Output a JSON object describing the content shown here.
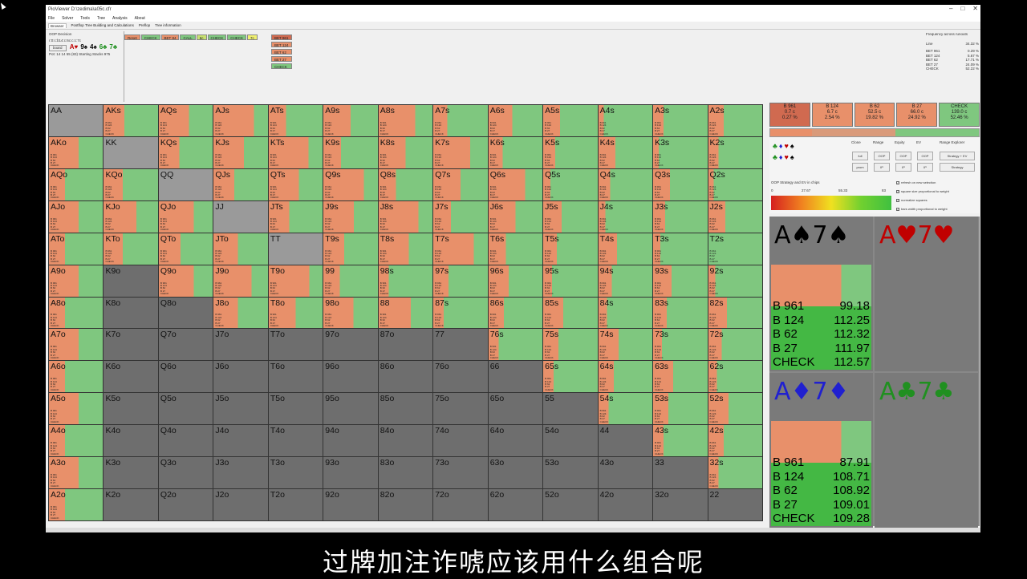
{
  "window": {
    "title": "PioViewer D:\\zedima\\a05c.cfr",
    "controls": [
      "–",
      "□",
      "✕"
    ]
  },
  "menu": [
    "File",
    "Solver",
    "Tools",
    "Tree",
    "Analysis",
    "About"
  ],
  "tabs": [
    "Browser",
    "Postflop Tree Building and Calculations",
    "Preflop",
    "Tree information"
  ],
  "info": {
    "decision": "OOP Decision",
    "path": "r:0:c:b14:c:6c:c:c:7c",
    "board_label": "board",
    "board": [
      {
        "t": "A♥",
        "c": "#c00000"
      },
      {
        "t": "9♠",
        "c": "#000000"
      },
      {
        "t": "4♠",
        "c": "#000000"
      },
      {
        "t": "6♣",
        "c": "#209020"
      },
      {
        "t": "7♣",
        "c": "#209020"
      }
    ],
    "stacks": "Pot: 14 14 55 (83) Starting Stacks 975"
  },
  "actions": [
    {
      "label": "Reset",
      "bg": "#e8906a"
    },
    {
      "label": "CHECK",
      "bg": "#7fc77f"
    },
    {
      "label": "BET 84",
      "bg": "#e8906a"
    },
    {
      "label": "CALL",
      "bg": "#7fc77f"
    },
    {
      "label": "6c",
      "bg": "#c8e070"
    },
    {
      "label": "CHECK",
      "bg": "#7fc77f"
    },
    {
      "label": "CHECK",
      "bg": "#7fc77f"
    },
    {
      "label": "7c",
      "bg": "#f0f070"
    }
  ],
  "bet_options": [
    {
      "label": "BET 961",
      "bg": "#d06a50"
    },
    {
      "label": "BET 124",
      "bg": "#e8906a"
    },
    {
      "label": "BET 62",
      "bg": "#e8906a"
    },
    {
      "label": "BET 27",
      "bg": "#e8906a"
    },
    {
      "label": "CHECK",
      "bg": "#7fc77f"
    }
  ],
  "frequency": {
    "title": "Frequency across runouts",
    "line_label": "Line",
    "line_value": "34.32 %",
    "rows": [
      {
        "label": "BET 961",
        "value": "0.29 %"
      },
      {
        "label": "BET 124",
        "value": "5.67 %"
      },
      {
        "label": "BET 62",
        "value": "17.71 %"
      },
      {
        "label": "BET 27",
        "value": "24.09 %"
      },
      {
        "label": "CHECK",
        "value": "52.22 %"
      }
    ]
  },
  "matrix": {
    "rows": [
      [
        "AA",
        "AKs",
        "AQs",
        "AJs",
        "ATs",
        "A9s",
        "A8s",
        "A7s",
        "A6s",
        "A5s",
        "A4s",
        "A3s",
        "A2s"
      ],
      [
        "AKo",
        "KK",
        "KQs",
        "KJs",
        "KTs",
        "K9s",
        "K8s",
        "K7s",
        "K6s",
        "K5s",
        "K4s",
        "K3s",
        "K2s"
      ],
      [
        "AQo",
        "KQo",
        "QQ",
        "QJs",
        "QTs",
        "Q9s",
        "Q8s",
        "Q7s",
        "Q6s",
        "Q5s",
        "Q4s",
        "Q3s",
        "Q2s"
      ],
      [
        "AJo",
        "KJo",
        "QJo",
        "JJ",
        "JTs",
        "J9s",
        "J8s",
        "J7s",
        "J6s",
        "J5s",
        "J4s",
        "J3s",
        "J2s"
      ],
      [
        "ATo",
        "KTo",
        "QTo",
        "JTo",
        "TT",
        "T9s",
        "T8s",
        "T7s",
        "T6s",
        "T5s",
        "T4s",
        "T3s",
        "T2s"
      ],
      [
        "A9o",
        "K9o",
        "Q9o",
        "J9o",
        "T9o",
        "99",
        "98s",
        "97s",
        "96s",
        "95s",
        "94s",
        "93s",
        "92s"
      ],
      [
        "A8o",
        "K8o",
        "Q8o",
        "J8o",
        "T8o",
        "98o",
        "88",
        "87s",
        "86s",
        "85s",
        "84s",
        "83s",
        "82s"
      ],
      [
        "A7o",
        "K7o",
        "Q7o",
        "J7o",
        "T7o",
        "97o",
        "87o",
        "77",
        "76s",
        "75s",
        "74s",
        "73s",
        "72s"
      ],
      [
        "A6o",
        "K6o",
        "Q6o",
        "J6o",
        "T6o",
        "96o",
        "86o",
        "76o",
        "66",
        "65s",
        "64s",
        "63s",
        "62s"
      ],
      [
        "A5o",
        "K5o",
        "Q5o",
        "J5o",
        "T5o",
        "95o",
        "85o",
        "75o",
        "65o",
        "55",
        "54s",
        "53s",
        "52s"
      ],
      [
        "A4o",
        "K4o",
        "Q4o",
        "J4o",
        "T4o",
        "94o",
        "84o",
        "74o",
        "64o",
        "54o",
        "44",
        "43s",
        "42s"
      ],
      [
        "A3o",
        "K3o",
        "Q3o",
        "J3o",
        "T3o",
        "93o",
        "83o",
        "73o",
        "63o",
        "53o",
        "43o",
        "33",
        "32s"
      ],
      [
        "A2o",
        "K2o",
        "Q2o",
        "J2o",
        "T2o",
        "92o",
        "82o",
        "72o",
        "62o",
        "52o",
        "42o",
        "32o",
        "22"
      ]
    ],
    "line_labels": [
      "B 961",
      "B 124",
      "B 62",
      "B 27",
      "CHECK"
    ]
  },
  "strategy_colors": {
    "bet_big": "#d06a50",
    "bet": "#e8906a",
    "check": "#7fc77f",
    "empty": "#6e6e6e",
    "pair": "#9a9a9a"
  },
  "right_bets": [
    {
      "l1": "B 961",
      "l2": "0.7 c",
      "l3": "0.27 %",
      "bg": "#d06a50"
    },
    {
      "l1": "B 124",
      "l2": "6.7 c",
      "l3": "2.54 %",
      "bg": "#e8906a"
    },
    {
      "l1": "B 62",
      "l2": "52.5 c",
      "l3": "19.82 %",
      "bg": "#e8906a"
    },
    {
      "l1": "B 27",
      "l2": "66.0 c",
      "l3": "24.92 %",
      "bg": "#e8906a"
    },
    {
      "l1": "CHECK",
      "l2": "139.0 c",
      "l3": "52.46 %",
      "bg": "#7fc77f"
    }
  ],
  "suit_panel": {
    "row1": [
      "♣",
      "♦",
      "♥",
      "♠"
    ],
    "row2": [
      "♣",
      "♦",
      "♥",
      "♠"
    ],
    "headers": [
      "Clone",
      "Range",
      "Equity",
      "EV"
    ],
    "buttons_row1": [
      "full",
      "OOP",
      "OOP",
      "OOP"
    ],
    "buttons_row2": [
      "prom",
      "IP",
      "IP",
      "IP"
    ],
    "range_explorer": "Range Explorer",
    "strategy_ev": "Strategy + EV",
    "strategy": "Strategy",
    "ev_label": "OOP Strategy and EV in chips",
    "scale": [
      "0",
      "27.67",
      "55.33",
      "83"
    ],
    "checks": [
      {
        "label": "refresh on new selection",
        "on": "✓"
      },
      {
        "label": "square size proportional to weight",
        "on": "✓"
      },
      {
        "label": "normalize squares",
        "on": "✓"
      },
      {
        "label": "bars width proportional to weight",
        "on": "✓"
      }
    ]
  },
  "combos": [
    {
      "r1": "A",
      "s1": "♠",
      "r2": "7",
      "s2": "♠",
      "color": "#000000",
      "rows": [
        {
          "l": "B 961",
          "v": "99.18"
        },
        {
          "l": "B 124",
          "v": "112.25"
        },
        {
          "l": "B 62",
          "v": "112.32"
        },
        {
          "l": "B 27",
          "v": "111.97"
        },
        {
          "l": "CHECK",
          "v": "112.57"
        }
      ]
    },
    {
      "r1": "A",
      "s1": "♥",
      "r2": "7",
      "s2": "♥",
      "color": "#c00000",
      "rows": []
    },
    {
      "r1": "A",
      "s1": "♦",
      "r2": "7",
      "s2": "♦",
      "color": "#2020d0",
      "rows": [
        {
          "l": "B 961",
          "v": "87.91"
        },
        {
          "l": "B 124",
          "v": "108.71"
        },
        {
          "l": "B 62",
          "v": "108.92"
        },
        {
          "l": "B 27",
          "v": "109.01"
        },
        {
          "l": "CHECK",
          "v": "109.28"
        }
      ]
    },
    {
      "r1": "A",
      "s1": "♣",
      "r2": "7",
      "s2": "♣",
      "color": "#209020",
      "rows": []
    }
  ],
  "subtitle": "过牌加注诈唬应该用什么组合呢"
}
